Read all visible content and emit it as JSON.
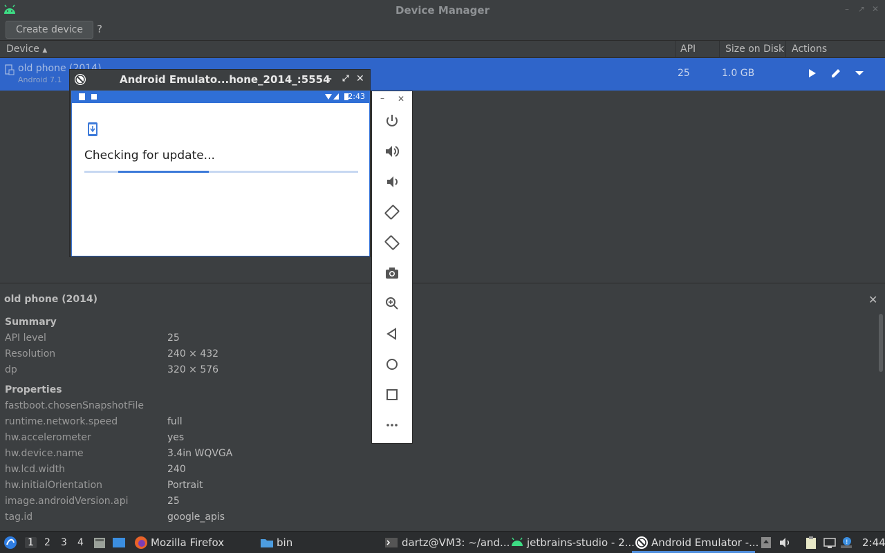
{
  "window": {
    "title": "Device Manager"
  },
  "toolbar": {
    "create_label": "Create device",
    "help_label": "?"
  },
  "table": {
    "columns": {
      "device": "Device",
      "api": "API",
      "size": "Size on Disk",
      "actions": "Actions"
    },
    "rows": [
      {
        "name": "old phone (2014)",
        "subtitle": "Android 7.1",
        "api": "25",
        "size": "1.0 GB"
      }
    ]
  },
  "emulator": {
    "title": "Android Emulato...hone_2014_:5554",
    "clock": "2:43",
    "message": "Checking for update...",
    "progress": 0.33
  },
  "details": {
    "title": "old phone (2014)",
    "summary_label": "Summary",
    "summary": [
      {
        "key": "API level",
        "value": "25"
      },
      {
        "key": "Resolution",
        "value": "240 × 432"
      },
      {
        "key": "dp",
        "value": "320 × 576"
      }
    ],
    "properties_label": "Properties",
    "properties": [
      {
        "key": "fastboot.chosenSnapshotFile",
        "value": ""
      },
      {
        "key": "runtime.network.speed",
        "value": "full"
      },
      {
        "key": "hw.accelerometer",
        "value": "yes"
      },
      {
        "key": "hw.device.name",
        "value": "3.4in WQVGA"
      },
      {
        "key": "hw.lcd.width",
        "value": "240"
      },
      {
        "key": "hw.initialOrientation",
        "value": "Portrait"
      },
      {
        "key": "image.androidVersion.api",
        "value": "25"
      },
      {
        "key": "tag.id",
        "value": "google_apis"
      }
    ]
  },
  "taskbar": {
    "workspaces": [
      "1",
      "2",
      "3",
      "4"
    ],
    "tasks": [
      {
        "label": "Mozilla Firefox"
      },
      {
        "label": "bin"
      },
      {
        "label": "dartz@VM3: ~/and..."
      },
      {
        "label": "jetbrains-studio - 2..."
      },
      {
        "label": "Android Emulator -..."
      }
    ],
    "clock": "2:44"
  },
  "colors": {
    "accent": "#2f65ca",
    "background": "#3c3f41",
    "emulator_status": "#2f6fd6"
  }
}
